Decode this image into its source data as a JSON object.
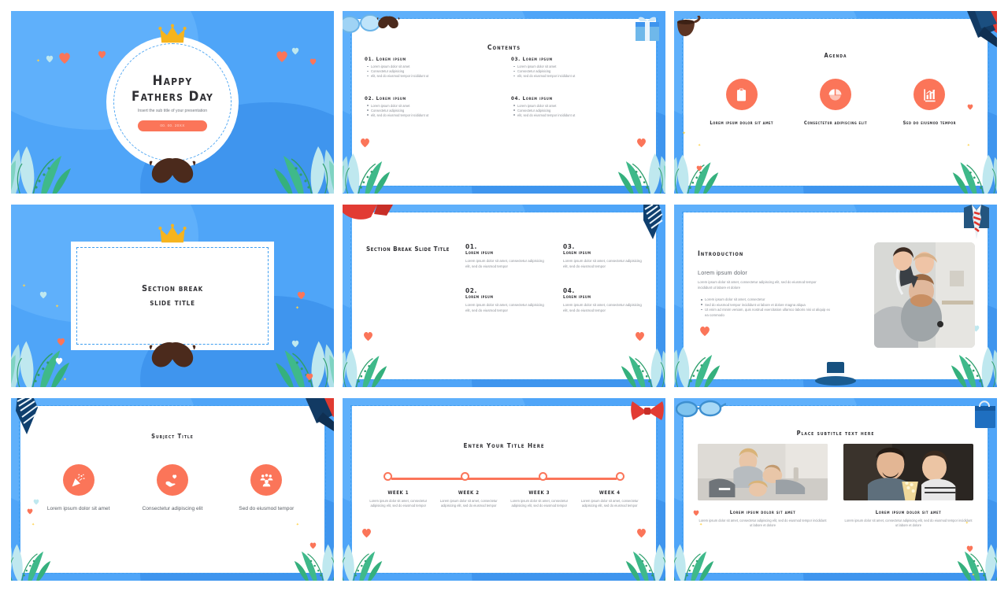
{
  "theme": {
    "background_blue": "#4FA5F8",
    "accent_coral": "#FB7559",
    "crown_yellow": "#F6B41E",
    "dash_blue": "#3F9EF0",
    "mustache_brown": "#4B2A1C",
    "text_dark": "#2F2F33",
    "text_muted": "#8B8F96"
  },
  "slides": [
    {
      "id": "cover",
      "name": "Happy Fathers Day Cover",
      "title_line1": "Happy",
      "title_line2": "Fathers Day",
      "subtitle": "Insert the sub title of your presentation",
      "date_badge": "00. 00. 20XX",
      "decorations": [
        "crown-icon",
        "mustache-icon",
        "leaf-plant-icon",
        "heart-icon",
        "sparkle-icon"
      ]
    },
    {
      "id": "contents",
      "name": "Contents",
      "title": "Contents",
      "items": [
        {
          "number": "01.",
          "heading": "Lorem ipsum",
          "bullets": [
            "Lorem ipsum dolor sit amet",
            "Consectetur adipisicing",
            "elit, sed do eiusmod tempor incididunt ut"
          ]
        },
        {
          "number": "03.",
          "heading": "Lorem ipsum",
          "bullets": [
            "Lorem ipsum dolor sit amet",
            "Consectetur adipisicing",
            "elit, sed do eiusmod tempor incididunt ut"
          ]
        },
        {
          "number": "02.",
          "heading": "Lorem ipsum",
          "bullets": [
            "Lorem ipsum dolor sit amet",
            "Consectetur adipisicing",
            "elit, sed do eiusmod tempor incididunt ut"
          ]
        },
        {
          "number": "04.",
          "heading": "Lorem ipsum",
          "bullets": [
            "Lorem ipsum dolor sit amet",
            "Consectetur adipisicing",
            "elit, sed do eiusmod tempor incididunt ut"
          ]
        }
      ],
      "decorations": [
        "glasses-icon",
        "mustache-icon",
        "gift-box-icon",
        "heart-icon",
        "leaf-plant-icon"
      ]
    },
    {
      "id": "agenda",
      "name": "Agenda",
      "title": "Agenda",
      "items": [
        {
          "icon": "clipboard-list-icon",
          "label": "Lorem ipsum dolor sit amet"
        },
        {
          "icon": "pie-chart-icon",
          "label": "Consectetur adipiscing elit"
        },
        {
          "icon": "bar-chart-icon",
          "label": "Sed do eiusmod tempor"
        }
      ],
      "decorations": [
        "pipe-icon",
        "necktie-icon",
        "leaf-plant-icon",
        "sparkle-icon"
      ]
    },
    {
      "id": "section-break",
      "name": "Section Break",
      "title_line1": "Section break",
      "title_line2": "slide title",
      "decorations": [
        "crown-icon",
        "mustache-icon",
        "leaf-plant-icon",
        "heart-icon",
        "sparkle-icon"
      ]
    },
    {
      "id": "section-break-detail",
      "name": "Section Break Slide Title",
      "title": "Section Break Slide Title",
      "items": [
        {
          "number": "01.",
          "heading": "Lorem ipsum",
          "body": "Lorem ipsum dolor sit amet, consectetur adipisicing elit, sed do eiusmod tempor"
        },
        {
          "number": "03.",
          "heading": "Lorem ipsum",
          "body": "Lorem ipsum dolor sit amet, consectetur adipisicing elit, sed do eiusmod tempor"
        },
        {
          "number": "02.",
          "heading": "Lorem ipsum",
          "body": "Lorem ipsum dolor sit amet, consectetur adipisicing elit, sed do eiusmod tempor"
        },
        {
          "number": "04.",
          "heading": "Lorem ipsum",
          "body": "Lorem ipsum dolor sit amet, consectetur adipisicing elit, sed do eiusmod tempor"
        }
      ],
      "decorations": [
        "red-bow-icon",
        "striped-necktie-icon",
        "heart-icon",
        "leaf-plant-icon"
      ]
    },
    {
      "id": "introduction",
      "name": "Introduction",
      "title": "Introduction",
      "subtitle": "Lorem ipsum dolor",
      "paragraph": "Lorem ipsum dolor sit amet, consectetur adipiscing elit, sed do eiusmod tempor incididunt ut labore et dolore",
      "bullets": [
        "Lorem ipsum dolor sit amet, consectetur",
        "Sed do eiusmod tempor incididunt ut labore et dolore magna aliqua",
        "Ut enim ad minim veniam, quis nostrud exercitation ullamco laboris nisi ut aliquip ex ea commodo"
      ],
      "photo_alt": "family father child on shoulders",
      "decorations": [
        "shirt-tie-icon",
        "top-hat-icon",
        "heart-icon",
        "leaf-plant-icon"
      ]
    },
    {
      "id": "subject-title",
      "name": "Subject Title",
      "title": "Subject Title",
      "items": [
        {
          "icon": "party-popper-icon",
          "label": "Lorem ipsum dolor sit amet"
        },
        {
          "icon": "hand-heart-icon",
          "label": "Consectetur adipiscing elit"
        },
        {
          "icon": "people-group-icon",
          "label": "Sed do eiusmod tempor"
        }
      ],
      "decorations": [
        "striped-necktie-icon",
        "navy-necktie-icon",
        "leaf-plant-icon",
        "heart-icon",
        "sparkle-icon"
      ]
    },
    {
      "id": "timeline",
      "name": "Enter Your Title Here",
      "title": "Enter Your Title Here",
      "steps": [
        {
          "label": "WEEK 1",
          "body": "Lorem ipsum dolor sit amet, consectetur adipisicing elit, sed do eiusmod tempor"
        },
        {
          "label": "WEEK 2",
          "body": "Lorem ipsum dolor sit amet, consectetur adipisicing elit, sed do eiusmod tempor"
        },
        {
          "label": "WEEK 3",
          "body": "Lorem ipsum dolor sit amet, consectetur adipisicing elit, sed do eiusmod tempor"
        },
        {
          "label": "WEEK 4",
          "body": "Lorem ipsum dolor sit amet, consectetur adipisicing elit, sed do eiusmod tempor"
        }
      ],
      "decorations": [
        "red-bow-icon",
        "heart-icon",
        "leaf-plant-icon"
      ]
    },
    {
      "id": "two-photos",
      "name": "Place subtitle text here",
      "title": "Place subtitle text here",
      "items": [
        {
          "heading": "Lorem ipsum dolor sit amet",
          "body": "Lorem ipsum dolor sit amet, consectetur adipiscing elit, sed do eiusmod tempor incididunt ut labore et dolore",
          "photo_alt": "family lying on floor"
        },
        {
          "heading": "Lorem ipsum dolor sit amet",
          "body": "Lorem ipsum dolor sit amet, consectetur adipiscing elit, sed do eiusmod tempor incididunt ut labore et dolore",
          "photo_alt": "father and child with popcorn"
        }
      ],
      "decorations": [
        "glasses-icon",
        "gift-bag-icon",
        "heart-icon",
        "sparkle-icon",
        "leaf-plant-icon"
      ]
    }
  ]
}
